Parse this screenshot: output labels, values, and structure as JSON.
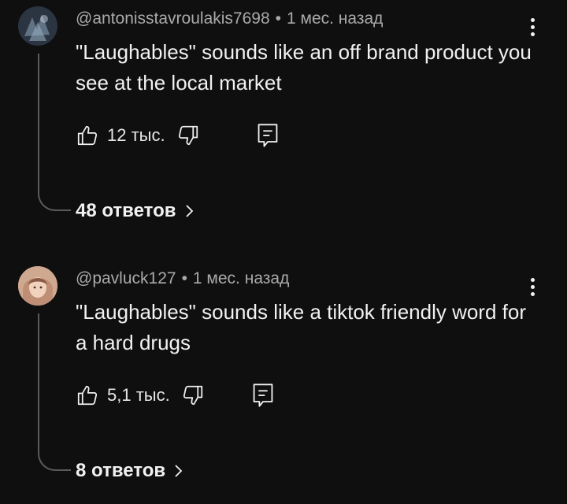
{
  "comments": [
    {
      "author": "@antonisstavroulakis7698",
      "time": "1 мес. назад",
      "separator": "•",
      "text": "\"Laughables\" sounds like an off brand product you see at the local market",
      "likes": "12 тыс.",
      "replies": "48 ответов",
      "avatar_colors": {
        "bg": "#2a3440",
        "fg": "#8fa0b3"
      },
      "icons": [
        "thumb-up-icon",
        "thumb-down-icon",
        "reply-icon",
        "more-vert-icon",
        "chevron-right-icon"
      ]
    },
    {
      "author": "@pavluck127",
      "time": "1 мес. назад",
      "separator": "•",
      "text": "\"Laughables\" sounds like a tiktok friendly word for a hard drugs",
      "likes": "5,1 тыс.",
      "replies": "8 ответов",
      "avatar_colors": {
        "bg": "#caa48c",
        "fg": "#5a3b2e"
      },
      "icons": [
        "thumb-up-icon",
        "thumb-down-icon",
        "reply-icon",
        "more-vert-icon",
        "chevron-right-icon"
      ]
    }
  ],
  "theme": {
    "background": "#0f0f0f",
    "text": "#f1f1f1",
    "secondary_text": "#aaaaaa",
    "thread_line": "#5a5a5a"
  }
}
